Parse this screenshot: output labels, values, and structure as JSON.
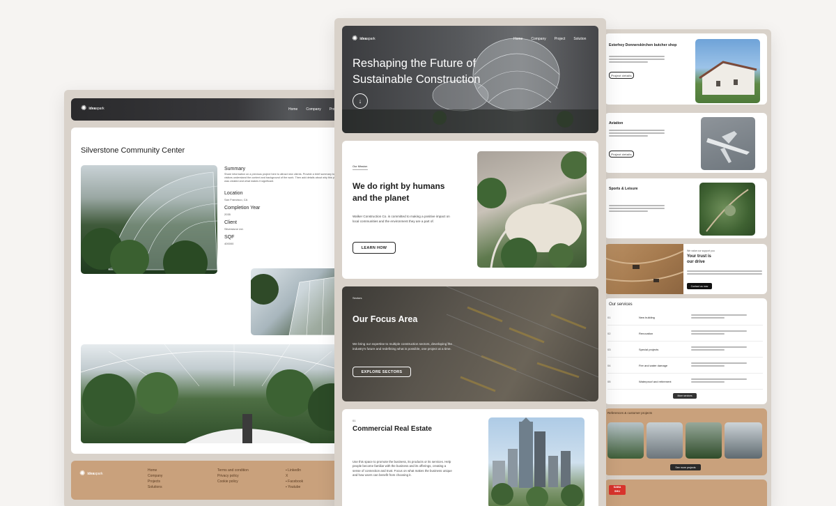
{
  "brand": {
    "name_bold": "idea",
    "name_rest": "spark"
  },
  "nav": {
    "home": "Home",
    "company": "Company",
    "project": "Project",
    "solution": "Solution"
  },
  "left": {
    "title": "Silverstone Community Center",
    "summary_label": "Summary",
    "summary_text": "Share information on a previous project here to attract new clients. Provide a brief summary to help visitors understand the context and background of the work. Then add details about why this project was created and what makes it significant.",
    "location_label": "Location",
    "location_value": "San Francisco, CA",
    "completion_label": "Completion Year",
    "completion_value": "2035",
    "client_label": "Client",
    "client_value": "Silverstone Ltd.",
    "sqf_label": "SQF",
    "sqf_value": "400000",
    "footer": {
      "col1": [
        "Home",
        "Company",
        "Projects",
        "Solutions"
      ],
      "col2": [
        "Terms and condition",
        "Privacy policy",
        "Cookie policy"
      ],
      "col3": [
        "LinkedIn",
        "X",
        "Facebook",
        "Youtube"
      ]
    }
  },
  "center": {
    "hero_title_1": "Reshaping the Future of",
    "hero_title_2": "Sustainable Construction",
    "hero_down_icon": "arrow-down-icon",
    "mission_eyebrow": "Our Mission",
    "mission_title_1": "We do right by humans",
    "mission_title_2": "and the planet",
    "mission_text": "Walker Construction Co. is committed to making a positive impact on local communities and the environment they are a part of.",
    "learn_how": "LEARN HOW",
    "focus_eyebrow": "Sectors",
    "focus_title": "Our Focus Area",
    "focus_text": "We bring our expertise to multiple construction sectors, developing the industry's future and redefining what is possible, one project at a time.",
    "explore": "EXPLORE SECTORS",
    "cre_num": "01",
    "cre_title": "Commercial Real Estate",
    "cre_text": "Use this space to promote the business, its products or its services. Help people become familiar with the business and its offerings, creating a sense of connection and trust. Focus on what makes the business unique and how users can benefit from choosing it."
  },
  "right": {
    "proj1_title": "Esterhoy Donnerskirchen butcher shop",
    "proj_details": "Project details",
    "proj2_title": "Aviation",
    "proj3_title": "Sports & Leisure",
    "trust_eyebrow": "We value our support you",
    "trust_title_1": "Your trust is",
    "trust_title_2": "our drive",
    "contact": "Contact us now",
    "services_title": "Our services",
    "services": [
      {
        "n": "01",
        "t": "New building"
      },
      {
        "n": "02",
        "t": "Renovation"
      },
      {
        "n": "03",
        "t": "Special projects"
      },
      {
        "n": "04",
        "t": "Fire and water damage"
      },
      {
        "n": "05",
        "t": "Waterproof and retirement"
      }
    ],
    "more_services": "More services",
    "refs_title": "References & customer projects",
    "see_more": "See more projects",
    "badge_1": "SABA",
    "badge_2": "SHU"
  },
  "colors": {
    "frame": "#d9d2ca",
    "footer": "#c9a17c",
    "dark_nav": "#2c2c2e"
  }
}
